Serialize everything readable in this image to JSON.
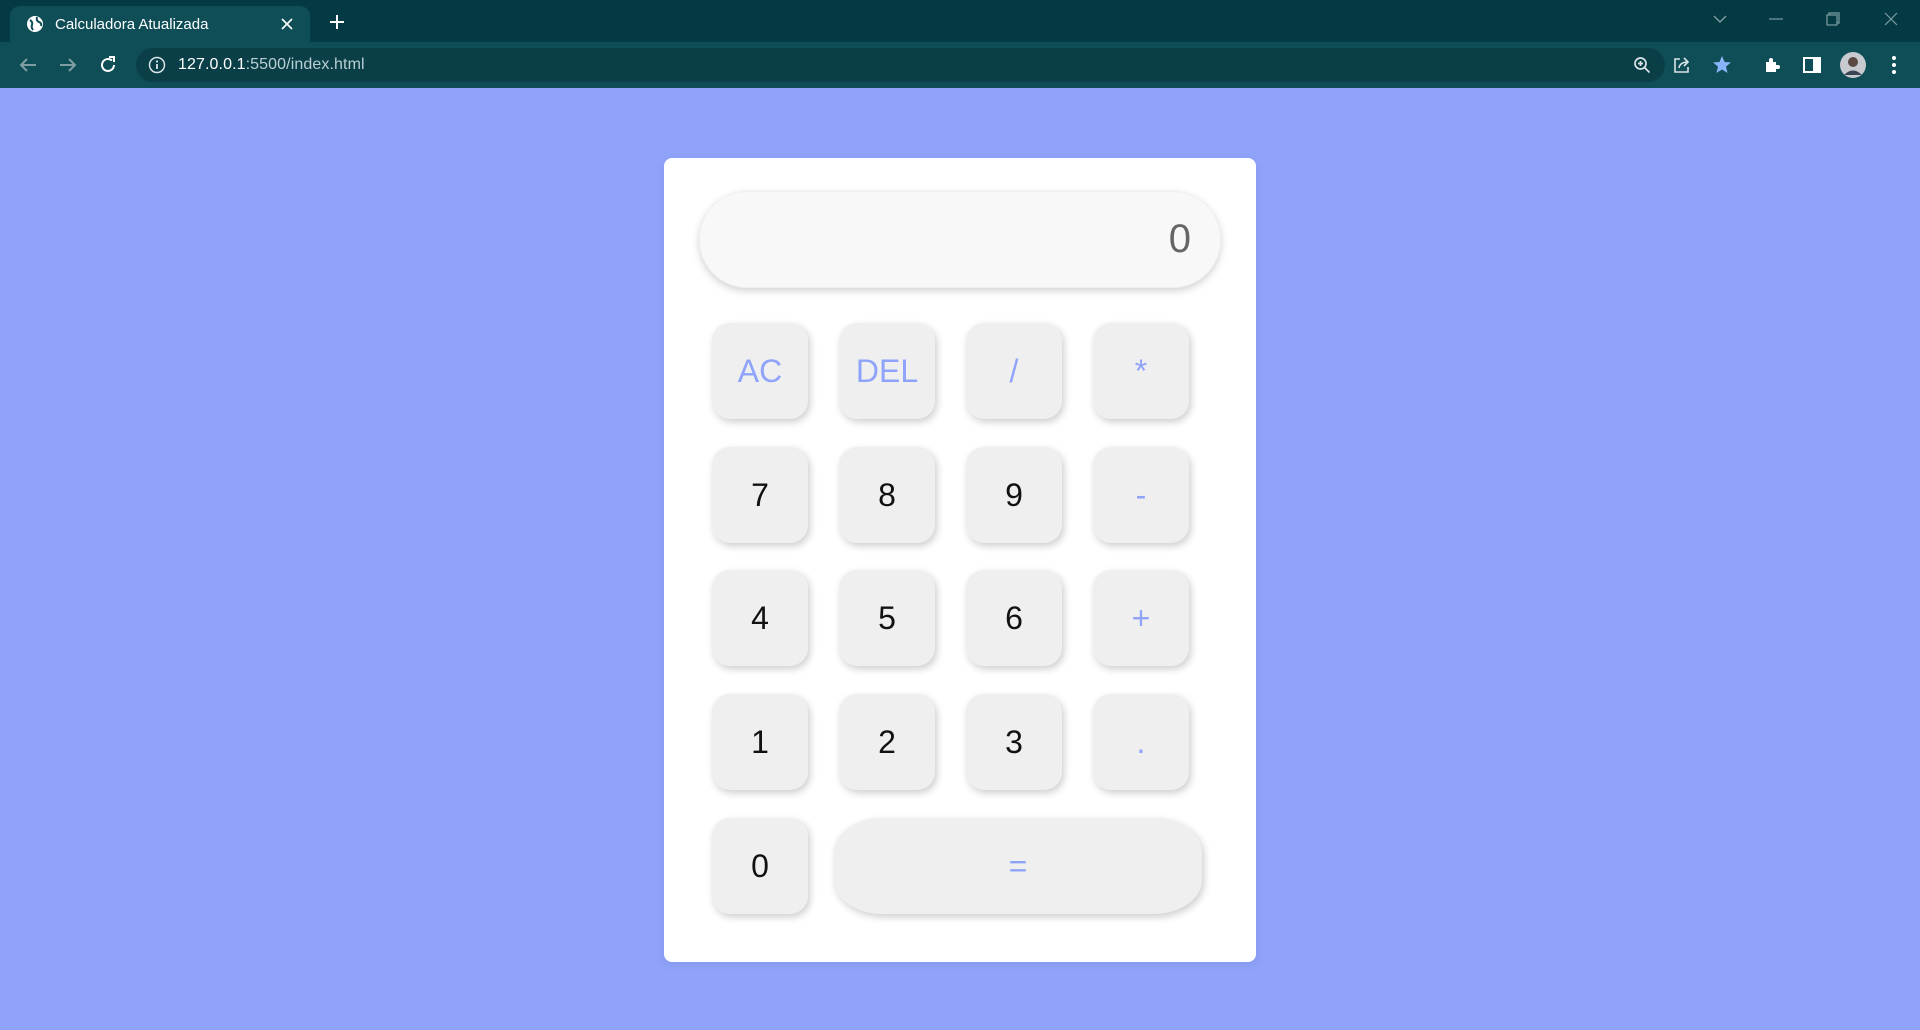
{
  "browser": {
    "tab_title": "Calculadora Atualizada",
    "url_host": "127.0.0.1",
    "url_path": ":5500/index.html"
  },
  "calculator": {
    "display_value": "0",
    "keys": {
      "ac": "AC",
      "del": "DEL",
      "divide": "/",
      "multiply": "*",
      "seven": "7",
      "eight": "8",
      "nine": "9",
      "minus": "-",
      "four": "4",
      "five": "5",
      "six": "6",
      "plus": "+",
      "one": "1",
      "two": "2",
      "three": "3",
      "decimal": ".",
      "zero": "0",
      "equals": "="
    }
  },
  "colors": {
    "page_background": "#8fa3fb",
    "operator_text": "#8fa3fb",
    "browser_frame": "#033a43",
    "browser_toolbar": "#0f4d57"
  }
}
